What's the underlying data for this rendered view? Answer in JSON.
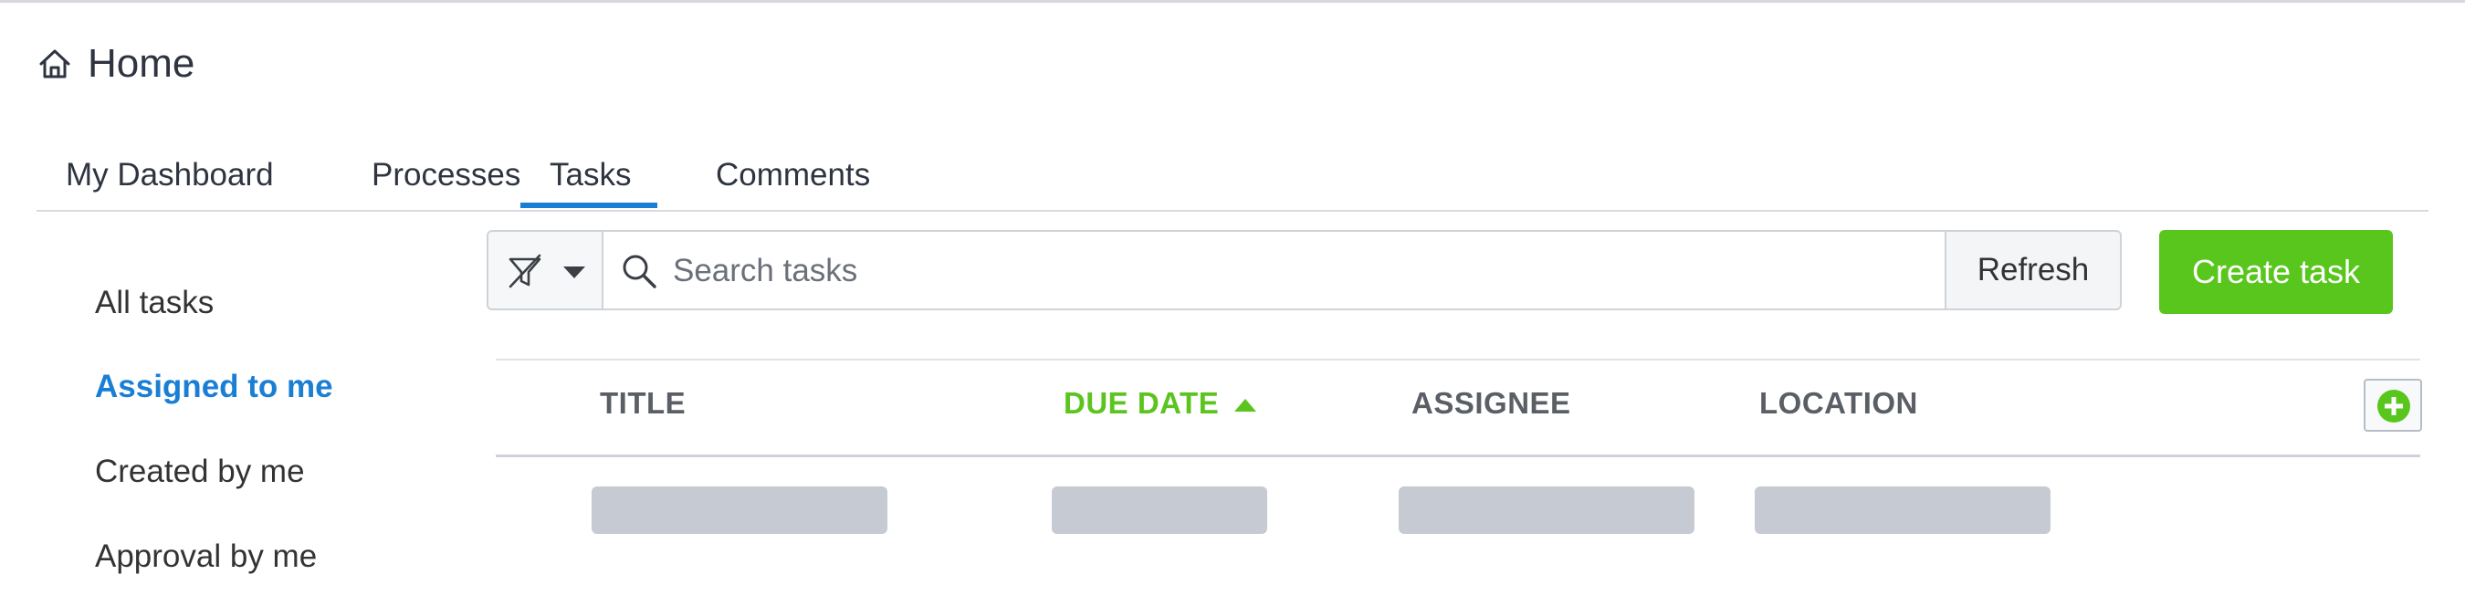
{
  "page": {
    "title": "Home"
  },
  "tabs": [
    {
      "label": "My Dashboard",
      "active": false
    },
    {
      "label": "Processes",
      "active": false
    },
    {
      "label": "Tasks",
      "active": true
    },
    {
      "label": "Comments",
      "active": false
    }
  ],
  "sidebar": {
    "items": [
      {
        "label": "All tasks",
        "active": false
      },
      {
        "label": "Assigned to me",
        "active": true
      },
      {
        "label": "Created by me",
        "active": false
      },
      {
        "label": "Approval by me",
        "active": false
      }
    ]
  },
  "toolbar": {
    "search_placeholder": "Search tasks",
    "refresh_label": "Refresh",
    "create_label": "Create task"
  },
  "table": {
    "columns": [
      {
        "label": "TITLE",
        "sorted": false
      },
      {
        "label": "DUE DATE",
        "sorted": true,
        "sort_direction": "ascending"
      },
      {
        "label": "ASSIGNEE",
        "sorted": false
      },
      {
        "label": "LOCATION",
        "sorted": false
      }
    ],
    "rows_loading": true
  },
  "icons": {
    "home": "home-icon",
    "filter": "filter-off-icon",
    "caret": "chevron-down-icon",
    "search": "search-icon",
    "sort": "sort-ascending-icon",
    "add_column": "plus-circle-icon"
  },
  "colors": {
    "accent_blue": "#1a7fd4",
    "primary_green": "#58c61c",
    "sorted_green": "#5bc41f",
    "skeleton": "#c5cad3"
  }
}
